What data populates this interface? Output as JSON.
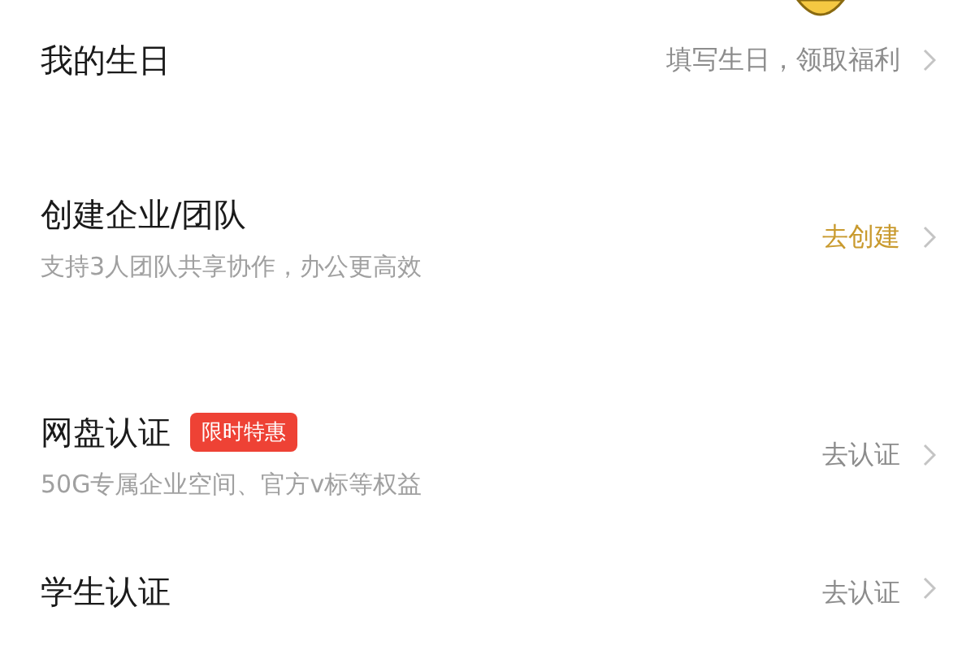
{
  "items": [
    {
      "title": "我的生日",
      "action": "填写生日，领取福利",
      "highlight": false
    },
    {
      "title": "创建企业/团队",
      "subtitle": "支持3人团队共享协作，办公更高效",
      "action": "去创建",
      "highlight": true
    },
    {
      "title": "网盘认证",
      "badge": "限时特惠",
      "subtitle": "50G专属企业空间、官方v标等权益",
      "action": "去认证",
      "highlight": false
    },
    {
      "title": "学生认证",
      "action": "去认证",
      "highlight": false
    }
  ]
}
